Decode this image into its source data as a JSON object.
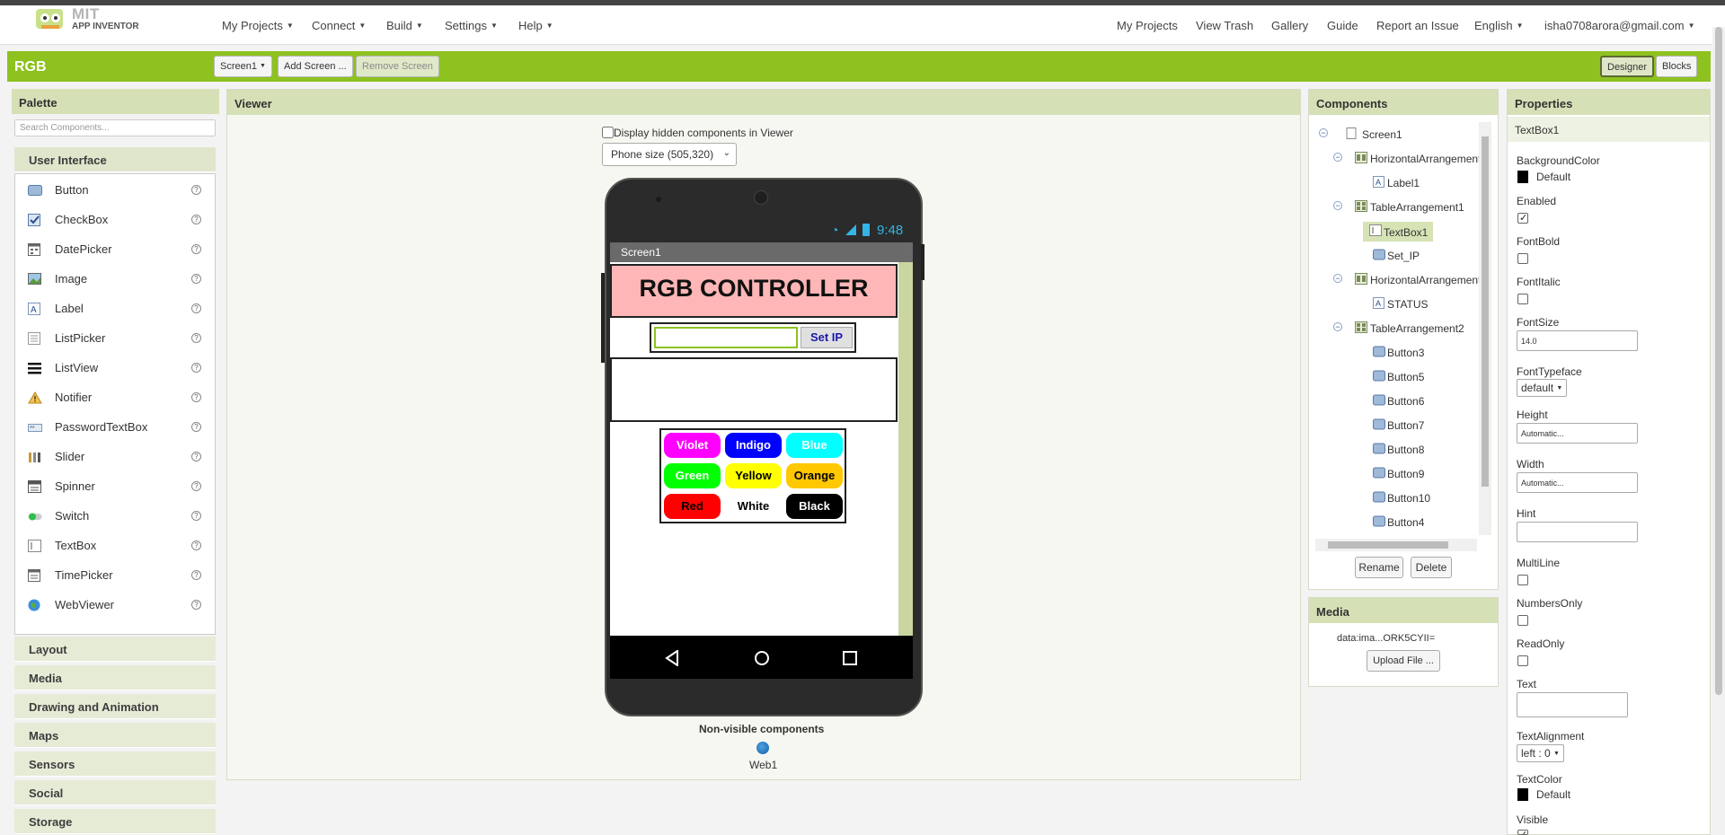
{
  "brand": {
    "line1": "MIT",
    "line2": "APP INVENTOR"
  },
  "top_menu": [
    "My Projects",
    "Connect",
    "Build",
    "Settings",
    "Help"
  ],
  "top_right": {
    "my_projects": "My Projects",
    "view_trash": "View Trash",
    "gallery": "Gallery",
    "guide": "Guide",
    "report": "Report an Issue",
    "language": "English",
    "account": "isha0708arora@gmail.com"
  },
  "project": {
    "name": "RGB",
    "screen_select": "Screen1",
    "add_screen": "Add Screen ...",
    "remove_screen": "Remove Screen",
    "designer": "Designer",
    "blocks": "Blocks"
  },
  "palette": {
    "title": "Palette",
    "search_placeholder": "Search Components...",
    "open_category": "User Interface",
    "items": [
      {
        "label": "Button",
        "icon": "button-icon"
      },
      {
        "label": "CheckBox",
        "icon": "checkbox-icon"
      },
      {
        "label": "DatePicker",
        "icon": "datepicker-icon"
      },
      {
        "label": "Image",
        "icon": "image-icon"
      },
      {
        "label": "Label",
        "icon": "label-icon"
      },
      {
        "label": "ListPicker",
        "icon": "listpicker-icon"
      },
      {
        "label": "ListView",
        "icon": "listview-icon"
      },
      {
        "label": "Notifier",
        "icon": "notifier-icon"
      },
      {
        "label": "PasswordTextBox",
        "icon": "password-icon"
      },
      {
        "label": "Slider",
        "icon": "slider-icon"
      },
      {
        "label": "Spinner",
        "icon": "spinner-icon"
      },
      {
        "label": "Switch",
        "icon": "switch-icon"
      },
      {
        "label": "TextBox",
        "icon": "textbox-icon"
      },
      {
        "label": "TimePicker",
        "icon": "timepicker-icon"
      },
      {
        "label": "WebViewer",
        "icon": "webviewer-icon"
      }
    ],
    "help_glyph": "?",
    "categories": [
      "Layout",
      "Media",
      "Drawing and Animation",
      "Maps",
      "Sensors",
      "Social",
      "Storage"
    ]
  },
  "viewer": {
    "title": "Viewer",
    "hidden_checkbox": "Display hidden components in Viewer",
    "phone_size": "Phone size (505,320)",
    "clock": "9:48",
    "screen_title": "Screen1",
    "app_title": "RGB CONTROLLER",
    "set_ip": "Set IP",
    "buttons": [
      {
        "label": "Violet",
        "bg": "#ff00ff",
        "fg": "#ffffff"
      },
      {
        "label": "Indigo",
        "bg": "#0000ff",
        "fg": "#ffffff"
      },
      {
        "label": "Blue",
        "bg": "#00ffff",
        "fg": "#ffffff"
      },
      {
        "label": "Green",
        "bg": "#00ff00",
        "fg": "#ffffff"
      },
      {
        "label": "Yellow",
        "bg": "#ffff00",
        "fg": "#000000"
      },
      {
        "label": "Orange",
        "bg": "#ffc800",
        "fg": "#000000"
      },
      {
        "label": "Red",
        "bg": "#ff0000",
        "fg": "#000000"
      },
      {
        "label": "White",
        "bg": "#ffffff",
        "fg": "#000000"
      },
      {
        "label": "Black",
        "bg": "#000000",
        "fg": "#ffffff"
      }
    ],
    "nonvisible_title": "Non-visible components",
    "nonvisible_item": "Web1"
  },
  "components": {
    "title": "Components",
    "tree": [
      {
        "label": "Screen1",
        "icon": "screen-icon",
        "toggle": "⊖"
      },
      {
        "label": "HorizontalArrangement1",
        "icon": "horizontal-arrangement-icon",
        "toggle": "⊖"
      },
      {
        "label": "Label1",
        "icon": "label-icon",
        "toggle": ""
      },
      {
        "label": "TableArrangement1",
        "icon": "table-arrangement-icon",
        "toggle": "⊖"
      },
      {
        "label": "TextBox1",
        "icon": "textbox-icon",
        "toggle": ""
      },
      {
        "label": "Set_IP",
        "icon": "button-icon",
        "toggle": ""
      },
      {
        "label": "HorizontalArrangement2",
        "icon": "horizontal-arrangement-icon",
        "toggle": "⊖"
      },
      {
        "label": "STATUS",
        "icon": "label-icon",
        "toggle": ""
      },
      {
        "label": "TableArrangement2",
        "icon": "table-arrangement-icon",
        "toggle": "⊖"
      },
      {
        "label": "Button3",
        "icon": "button-icon",
        "toggle": ""
      },
      {
        "label": "Button5",
        "icon": "button-icon",
        "toggle": ""
      },
      {
        "label": "Button6",
        "icon": "button-icon",
        "toggle": ""
      },
      {
        "label": "Button7",
        "icon": "button-icon",
        "toggle": ""
      },
      {
        "label": "Button8",
        "icon": "button-icon",
        "toggle": ""
      },
      {
        "label": "Button9",
        "icon": "button-icon",
        "toggle": ""
      },
      {
        "label": "Button10",
        "icon": "button-icon",
        "toggle": ""
      },
      {
        "label": "Button4",
        "icon": "button-icon",
        "toggle": ""
      }
    ],
    "rename": "Rename",
    "delete": "Delete"
  },
  "media": {
    "title": "Media",
    "file": "data:ima...ORK5CYII=",
    "upload": "Upload File ..."
  },
  "properties": {
    "title": "Properties",
    "selected": "TextBox1",
    "background_color_label": "BackgroundColor",
    "background_color_value": "Default",
    "enabled_label": "Enabled",
    "fontbold_label": "FontBold",
    "fontitalic_label": "FontItalic",
    "fontsize_label": "FontSize",
    "fontsize_value": "14.0",
    "fonttypeface_label": "FontTypeface",
    "fonttypeface_value": "default",
    "height_label": "Height",
    "height_value": "Automatic...",
    "width_label": "Width",
    "width_value": "Automatic...",
    "hint_label": "Hint",
    "multiline_label": "MultiLine",
    "numbersonly_label": "NumbersOnly",
    "readonly_label": "ReadOnly",
    "text_label": "Text",
    "textalignment_label": "TextAlignment",
    "textalignment_value": "left : 0",
    "textcolor_label": "TextColor",
    "textcolor_value": "Default",
    "visible_label": "Visible"
  }
}
